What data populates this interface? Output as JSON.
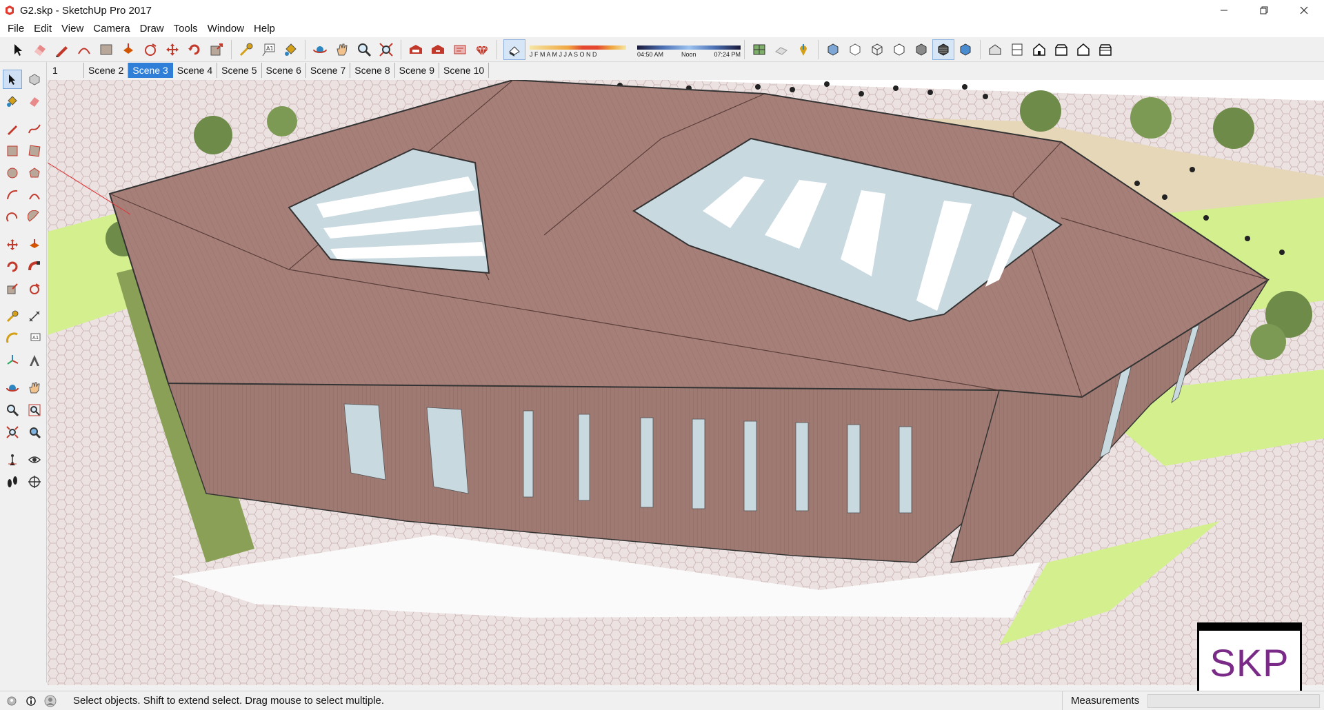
{
  "window": {
    "title": "G2.skp - SketchUp Pro 2017",
    "minimize_label": "–",
    "maximize_label": "❐",
    "close_label": "✕"
  },
  "menu": {
    "items": [
      "File",
      "Edit",
      "View",
      "Camera",
      "Draw",
      "Tools",
      "Window",
      "Help"
    ]
  },
  "shadows": {
    "months": "J F M A M J J A S O N D",
    "time_start": "04:50 AM",
    "time_mid": "Noon",
    "time_end": "07:24 PM"
  },
  "scenes": {
    "tabs": [
      "1",
      "Scene 2",
      "Scene 3",
      "Scene 4",
      "Scene 5",
      "Scene 6",
      "Scene 7",
      "Scene 8",
      "Scene 9",
      "Scene 10"
    ],
    "active": "Scene 3"
  },
  "statusbar": {
    "message": "Select objects. Shift to extend select. Drag mouse to select multiple.",
    "measurements_label": "Measurements",
    "measurements_value": ""
  },
  "badge": {
    "text": "SKP"
  },
  "colors": {
    "roof": "#a77f79",
    "wall": "#9e7a72",
    "glass": "#c9d9e0",
    "lawn": "#d3ef8e",
    "paving": "#e8dede",
    "accent": "#2f7fd8",
    "badge_text": "#7a2a87"
  }
}
